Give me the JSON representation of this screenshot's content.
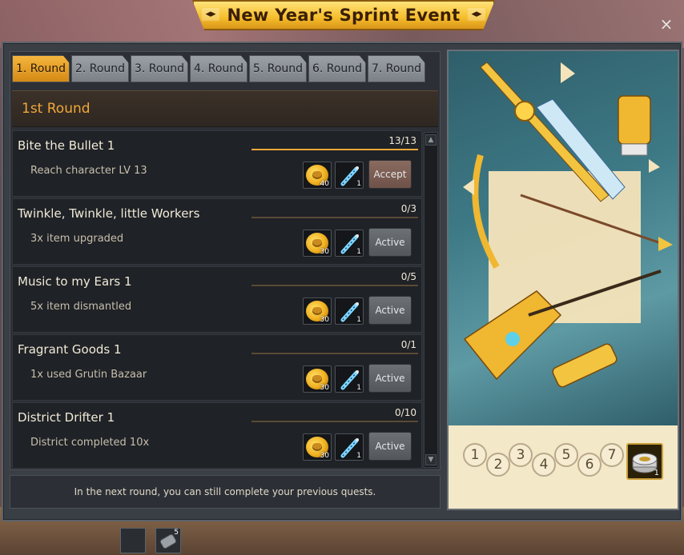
{
  "title": "New Year's Sprint Event",
  "close_label": "×",
  "tabs": [
    {
      "label": "1. Round",
      "active": true
    },
    {
      "label": "2. Round",
      "active": false
    },
    {
      "label": "3. Round",
      "active": false
    },
    {
      "label": "4. Round",
      "active": false
    },
    {
      "label": "5. Round",
      "active": false
    },
    {
      "label": "6. Round",
      "active": false
    },
    {
      "label": "7. Round",
      "active": false
    }
  ],
  "round_header": "1st Round",
  "quests": [
    {
      "title": "Bite the Bullet 1",
      "description": "Reach character LV 13",
      "progress": "13/13",
      "progress_fraction": 1.0,
      "rewards": [
        {
          "icon": "gold-coin-icon",
          "qty": "40"
        },
        {
          "icon": "syringe-icon",
          "qty": "1"
        }
      ],
      "button": "Accept"
    },
    {
      "title": "Twinkle, Twinkle, little Workers",
      "description": "3x item upgraded",
      "progress": "0/3",
      "progress_fraction": 0.0,
      "rewards": [
        {
          "icon": "gold-coin-icon",
          "qty": "30"
        },
        {
          "icon": "syringe-icon",
          "qty": "1"
        }
      ],
      "button": "Active"
    },
    {
      "title": "Music to my Ears 1",
      "description": "5x item dismantled",
      "progress": "0/5",
      "progress_fraction": 0.0,
      "rewards": [
        {
          "icon": "gold-coin-icon",
          "qty": "30"
        },
        {
          "icon": "syringe-icon",
          "qty": "1"
        }
      ],
      "button": "Active"
    },
    {
      "title": "Fragrant Goods 1",
      "description": "1x used Grutin Bazaar",
      "progress": "0/1",
      "progress_fraction": 0.0,
      "rewards": [
        {
          "icon": "gold-coin-icon",
          "qty": "30"
        },
        {
          "icon": "syringe-icon",
          "qty": "1"
        }
      ],
      "button": "Active"
    },
    {
      "title": "District Drifter 1",
      "description": "District completed 10x",
      "progress": "0/10",
      "progress_fraction": 0.0,
      "rewards": [
        {
          "icon": "gold-coin-icon",
          "qty": "30"
        },
        {
          "icon": "syringe-icon",
          "qty": "1"
        }
      ],
      "button": "Active"
    }
  ],
  "footer_note": "In the next round, you can still complete your previous quests.",
  "round_numbers": [
    "1",
    "2",
    "3",
    "4",
    "5",
    "6",
    "7"
  ],
  "final_reward": {
    "icon": "treasure-coin-icon",
    "qty": "1"
  },
  "hotbar": [
    {
      "icon": "empty-slot",
      "qty": ""
    },
    {
      "icon": "scroll-item-icon",
      "qty": "5"
    }
  ],
  "colors": {
    "accent": "#f0a83a",
    "tab_active": "#f5b53e",
    "tab_inactive": "#9aa0a6",
    "panel": "#2c3036"
  }
}
